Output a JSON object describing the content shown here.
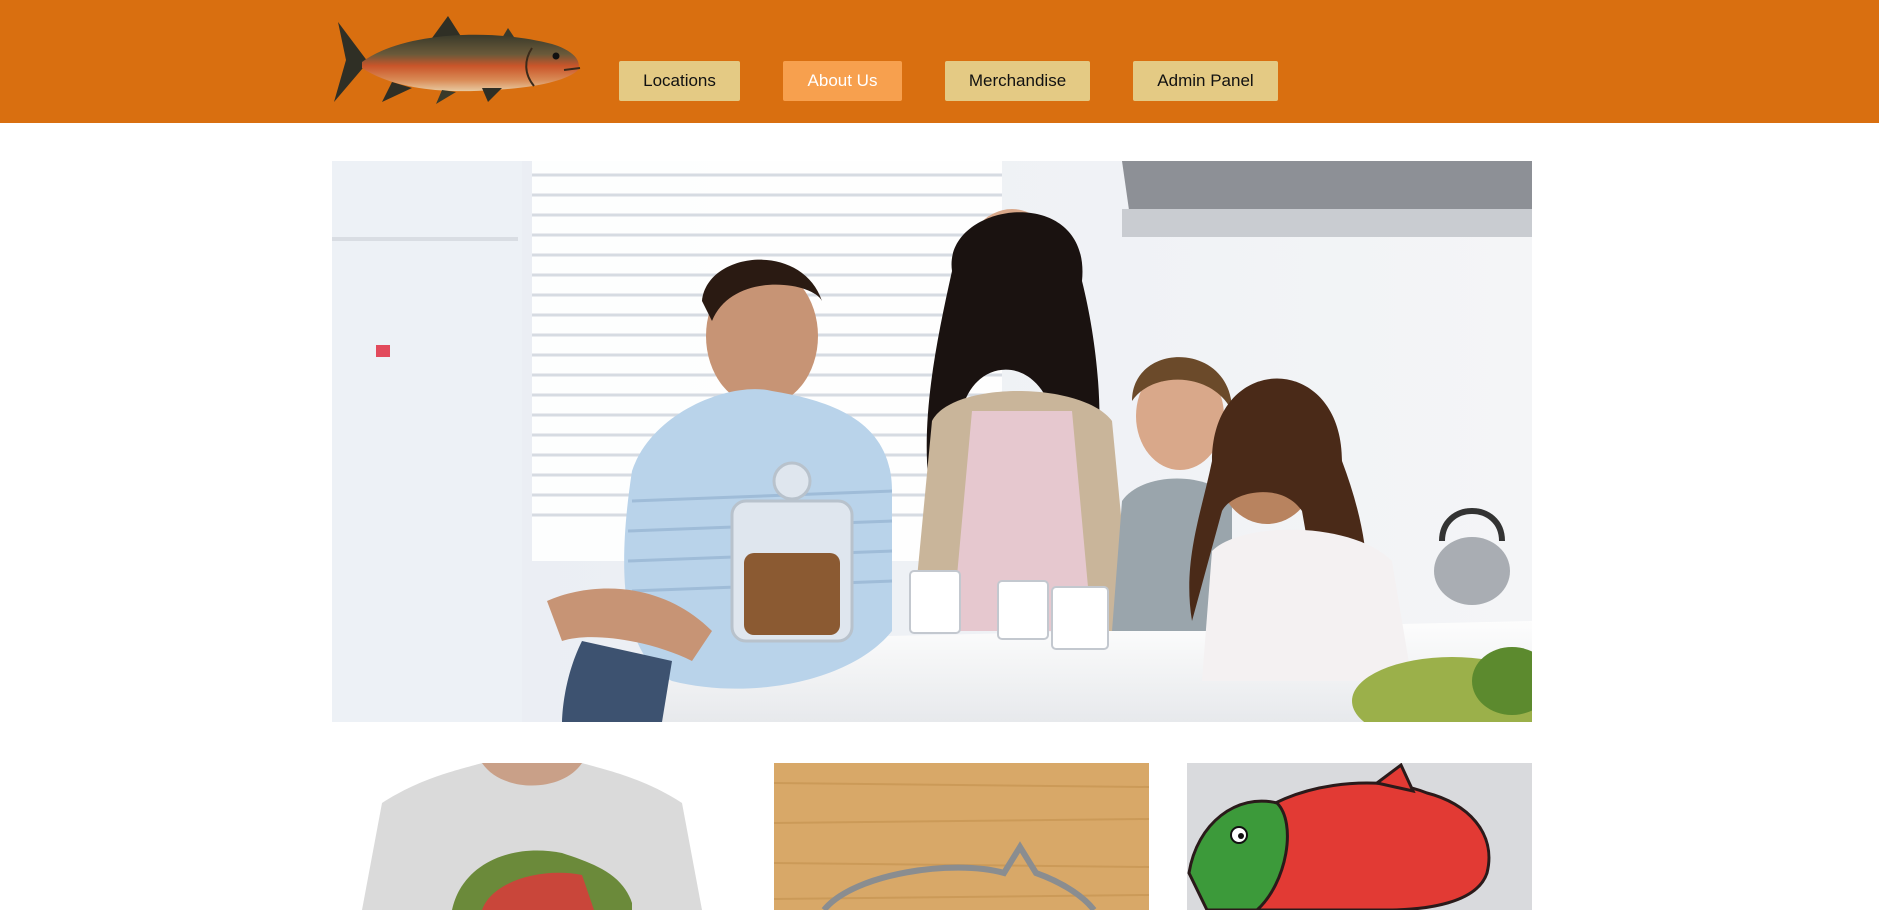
{
  "nav": {
    "items": [
      {
        "label": "Locations",
        "active": false
      },
      {
        "label": "About Us",
        "active": true
      },
      {
        "label": "Merchandise",
        "active": false
      },
      {
        "label": "Admin Panel",
        "active": false
      }
    ]
  },
  "colors": {
    "header_bg": "#d96f10",
    "button_bg": "#e4ca84",
    "button_active_bg": "#f7a04e"
  },
  "icons": {
    "logo": "salmon-logo-icon"
  }
}
